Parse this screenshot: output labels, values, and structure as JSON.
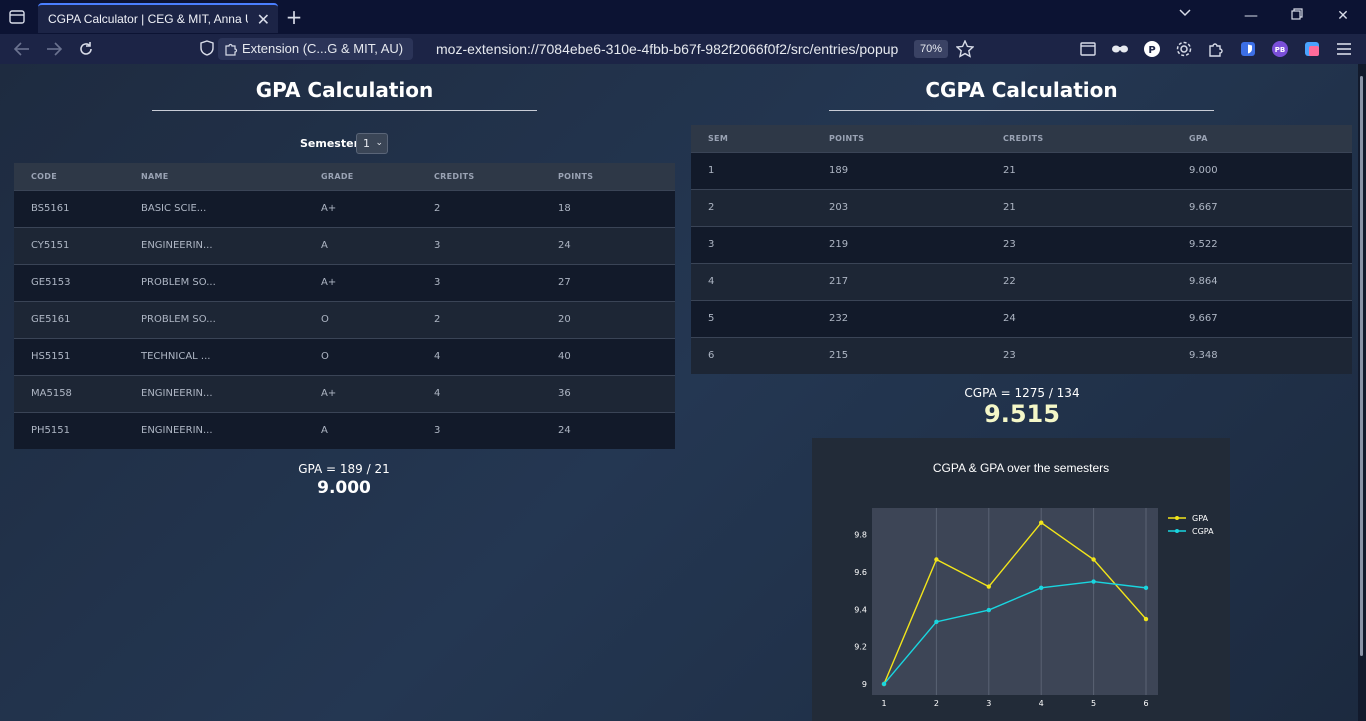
{
  "browser": {
    "tab_title": "CGPA Calculator | CEG & MIT, Anna Ur",
    "extension_label": "Extension (C...G & MIT, AU)",
    "url": "moz-extension://7084ebe6-310e-4fbb-b67f-982f2066f0f2/src/entries/popup",
    "zoom": "70%",
    "profile_badge": "PB"
  },
  "gpa": {
    "title": "GPA Calculation",
    "semester_label": "Semester",
    "semester_value": "1",
    "columns": [
      "CODE",
      "NAME",
      "GRADE",
      "CREDITS",
      "POINTS"
    ],
    "rows": [
      {
        "code": "BS5161",
        "name": "BASIC SCIE...",
        "grade": "A+",
        "credits": "2",
        "points": "18"
      },
      {
        "code": "CY5151",
        "name": "ENGINEERIN...",
        "grade": "A",
        "credits": "3",
        "points": "24"
      },
      {
        "code": "GE5153",
        "name": "PROBLEM SO...",
        "grade": "A+",
        "credits": "3",
        "points": "27"
      },
      {
        "code": "GE5161",
        "name": "PROBLEM SO...",
        "grade": "O",
        "credits": "2",
        "points": "20"
      },
      {
        "code": "HS5151",
        "name": "TECHNICAL ...",
        "grade": "O",
        "credits": "4",
        "points": "40"
      },
      {
        "code": "MA5158",
        "name": "ENGINEERIN...",
        "grade": "A+",
        "credits": "4",
        "points": "36"
      },
      {
        "code": "PH5151",
        "name": "ENGINEERIN...",
        "grade": "A",
        "credits": "3",
        "points": "24"
      }
    ],
    "formula": "GPA = 189 / 21",
    "result": "9.000"
  },
  "cgpa": {
    "title": "CGPA Calculation",
    "columns": [
      "SEM",
      "POINTS",
      "CREDITS",
      "GPA"
    ],
    "rows": [
      {
        "sem": "1",
        "points": "189",
        "credits": "21",
        "gpa": "9.000"
      },
      {
        "sem": "2",
        "points": "203",
        "credits": "21",
        "gpa": "9.667"
      },
      {
        "sem": "3",
        "points": "219",
        "credits": "23",
        "gpa": "9.522"
      },
      {
        "sem": "4",
        "points": "217",
        "credits": "22",
        "gpa": "9.864"
      },
      {
        "sem": "5",
        "points": "232",
        "credits": "24",
        "gpa": "9.667"
      },
      {
        "sem": "6",
        "points": "215",
        "credits": "23",
        "gpa": "9.348"
      }
    ],
    "formula": "CGPA = 1275 / 134",
    "result": "9.515"
  },
  "chart_data": {
    "type": "line",
    "title": "CGPA & GPA over the semesters",
    "x": [
      1,
      2,
      3,
      4,
      5,
      6
    ],
    "x_tick_labels": [
      "1",
      "2",
      "3",
      "4",
      "5",
      "6"
    ],
    "y_tick_labels": [
      "9",
      "9.2",
      "9.4",
      "9.6",
      "9.8"
    ],
    "ylim": [
      9,
      9.9
    ],
    "xlim": [
      1,
      6
    ],
    "legend_position": "right",
    "series": [
      {
        "name": "GPA",
        "color": "#f2e51a",
        "values": [
          9.0,
          9.667,
          9.522,
          9.864,
          9.667,
          9.348
        ]
      },
      {
        "name": "CGPA",
        "color": "#19d6e0",
        "values": [
          9.0,
          9.333,
          9.396,
          9.515,
          9.549,
          9.515
        ]
      }
    ]
  }
}
